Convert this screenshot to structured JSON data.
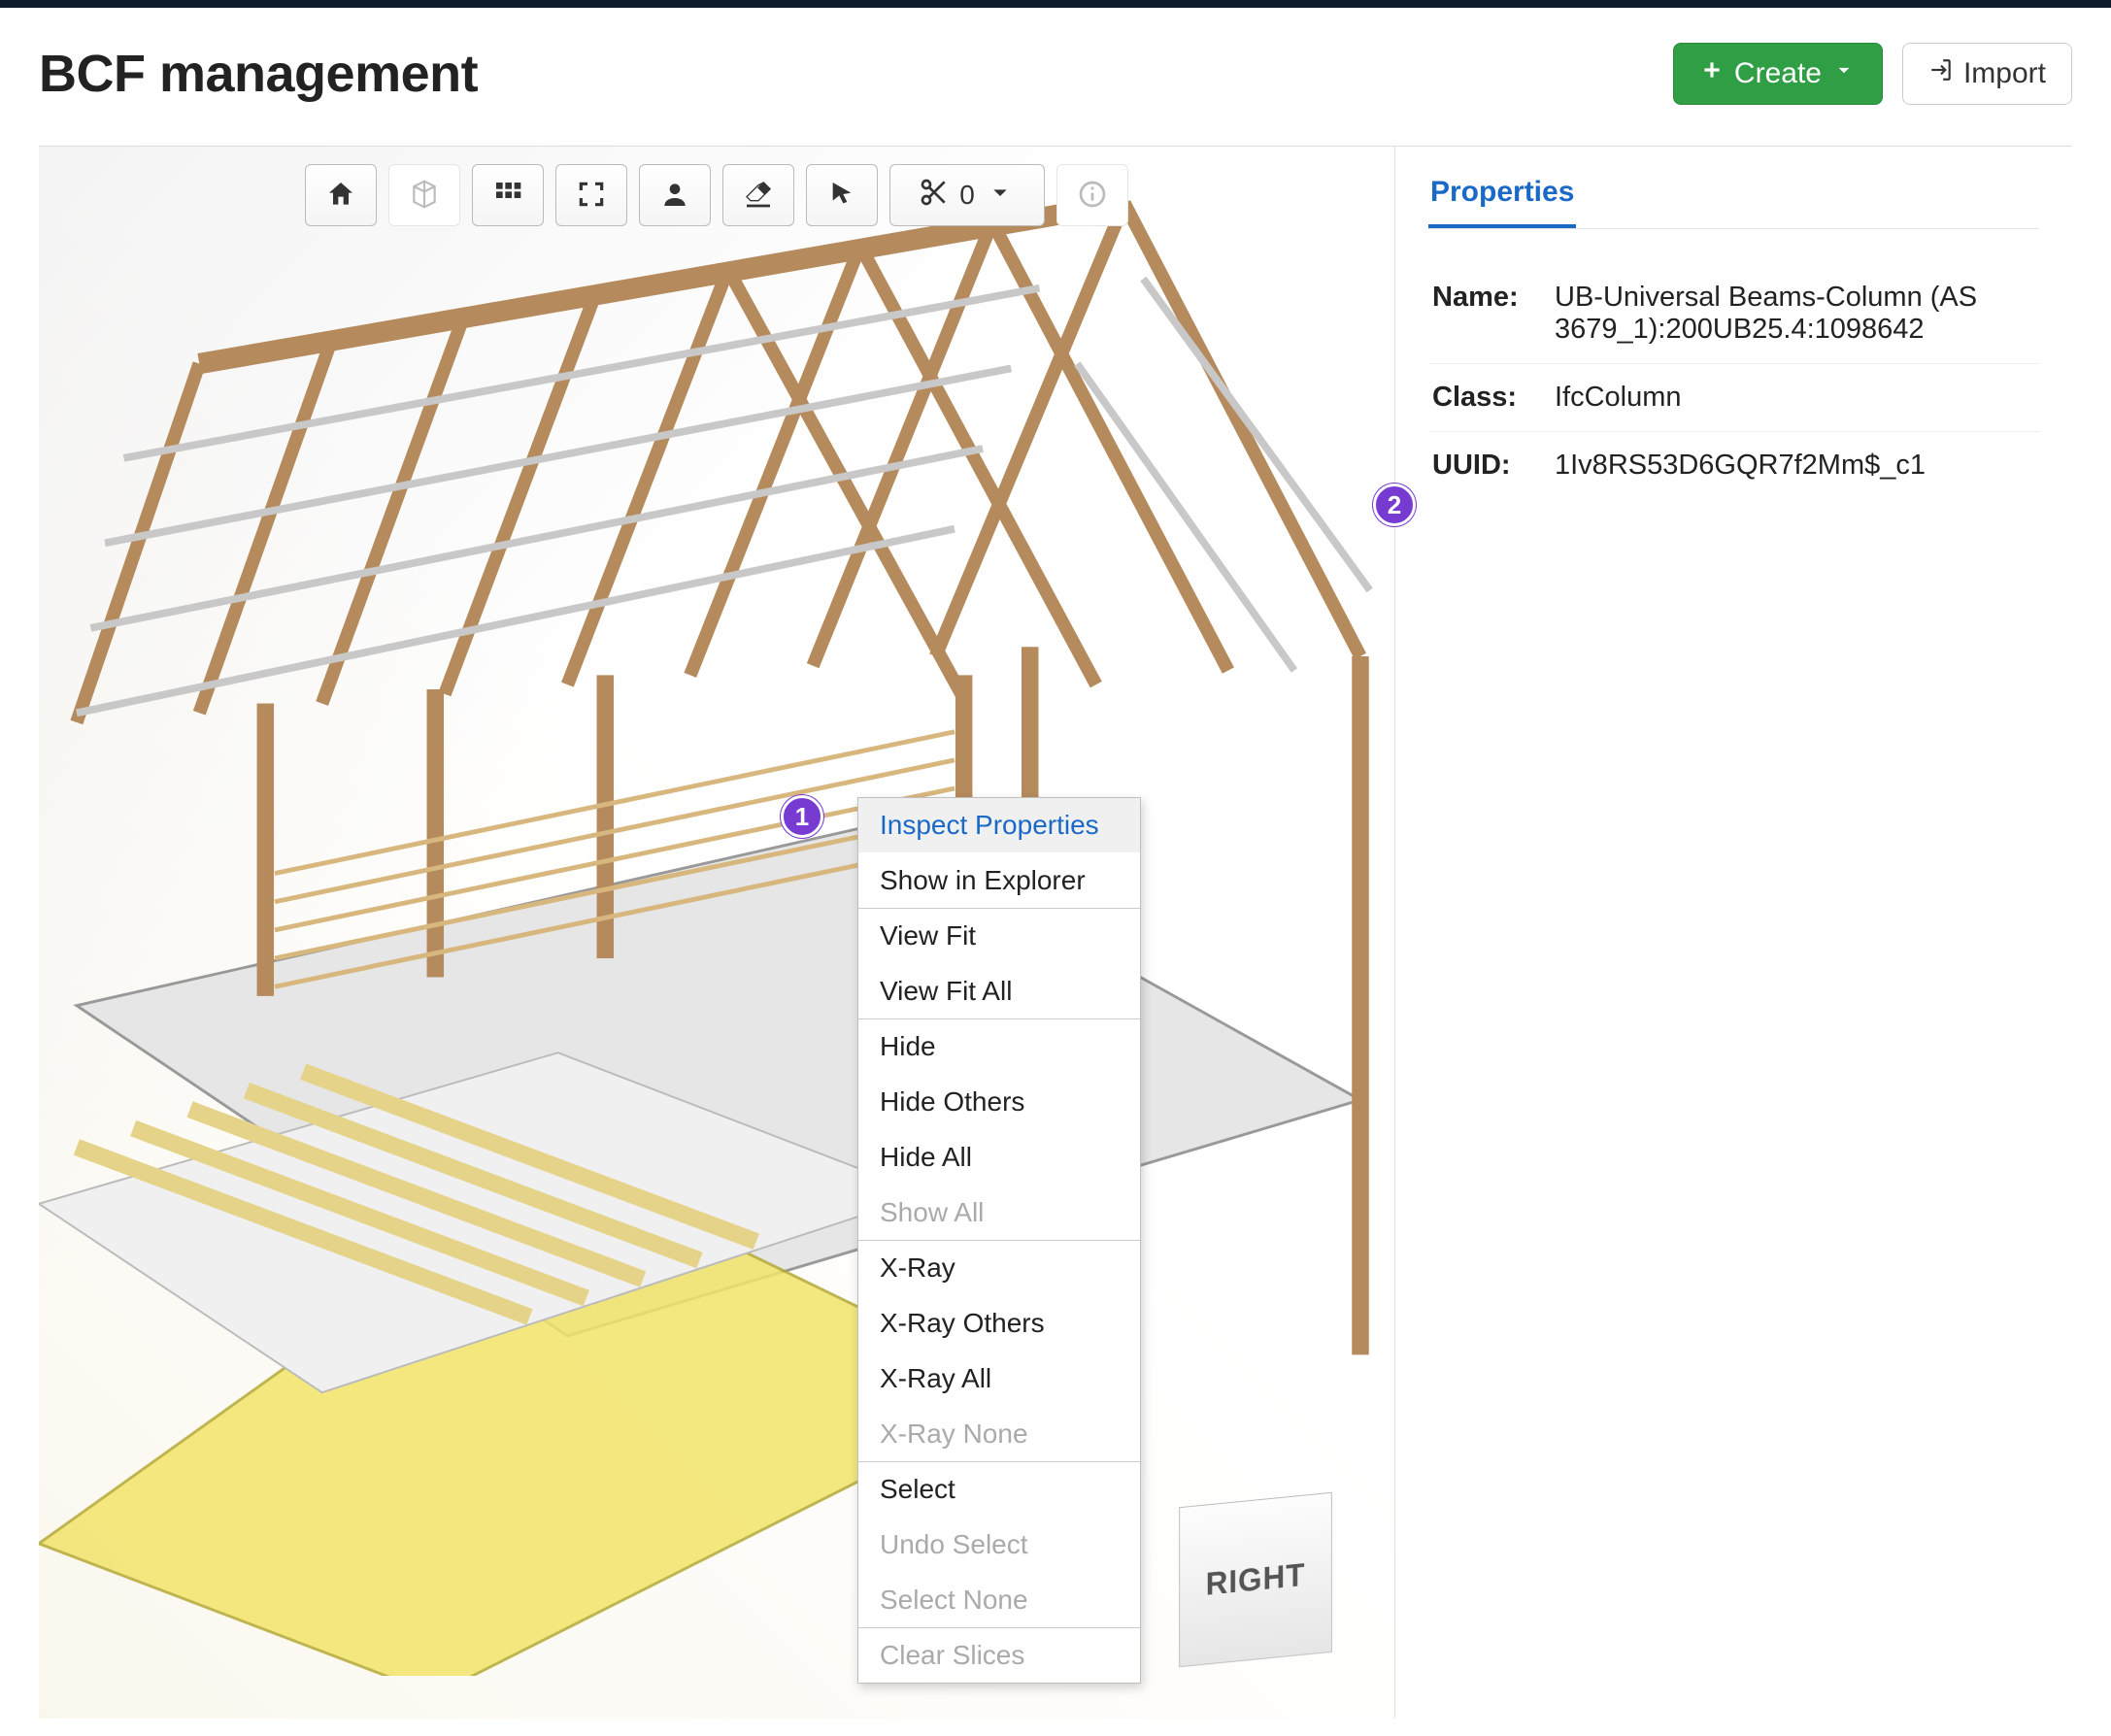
{
  "header": {
    "title": "BCF management",
    "create_label": "Create",
    "import_label": "Import"
  },
  "toolbar": {
    "home_tooltip": "Home view",
    "cube_tooltip": "Box view",
    "grid_tooltip": "Views",
    "fullscreen_tooltip": "Fullscreen",
    "user_tooltip": "Avatar",
    "eraser_tooltip": "Clear",
    "pointer_tooltip": "Select",
    "slice_count": "0",
    "info_tooltip": "Info"
  },
  "context_menu": {
    "items": [
      {
        "label": "Inspect Properties",
        "state": "active"
      },
      {
        "label": "Show in Explorer",
        "state": "enabled"
      },
      {
        "label": "View Fit",
        "state": "enabled",
        "group_start": true
      },
      {
        "label": "View Fit All",
        "state": "enabled"
      },
      {
        "label": "Hide",
        "state": "enabled",
        "group_start": true
      },
      {
        "label": "Hide Others",
        "state": "enabled"
      },
      {
        "label": "Hide All",
        "state": "enabled"
      },
      {
        "label": "Show All",
        "state": "disabled"
      },
      {
        "label": "X-Ray",
        "state": "enabled",
        "group_start": true
      },
      {
        "label": "X-Ray Others",
        "state": "enabled"
      },
      {
        "label": "X-Ray All",
        "state": "enabled"
      },
      {
        "label": "X-Ray None",
        "state": "disabled"
      },
      {
        "label": "Select",
        "state": "enabled",
        "group_start": true
      },
      {
        "label": "Undo Select",
        "state": "disabled"
      },
      {
        "label": "Select None",
        "state": "disabled"
      },
      {
        "label": "Clear Slices",
        "state": "disabled",
        "group_start": true
      }
    ]
  },
  "viewcube": {
    "face_label": "RIGHT"
  },
  "sidebar": {
    "tab_properties": "Properties",
    "props": {
      "name_key": "Name:",
      "name_val": "UB-Universal Beams-Column (AS 3679_1):200UB25.4:1098642",
      "class_key": "Class:",
      "class_val": "IfcColumn",
      "uuid_key": "UUID:",
      "uuid_val": "1Iv8RS53D6GQR7f2Mm$_c1"
    }
  },
  "markers": {
    "one": "1",
    "two": "2"
  }
}
